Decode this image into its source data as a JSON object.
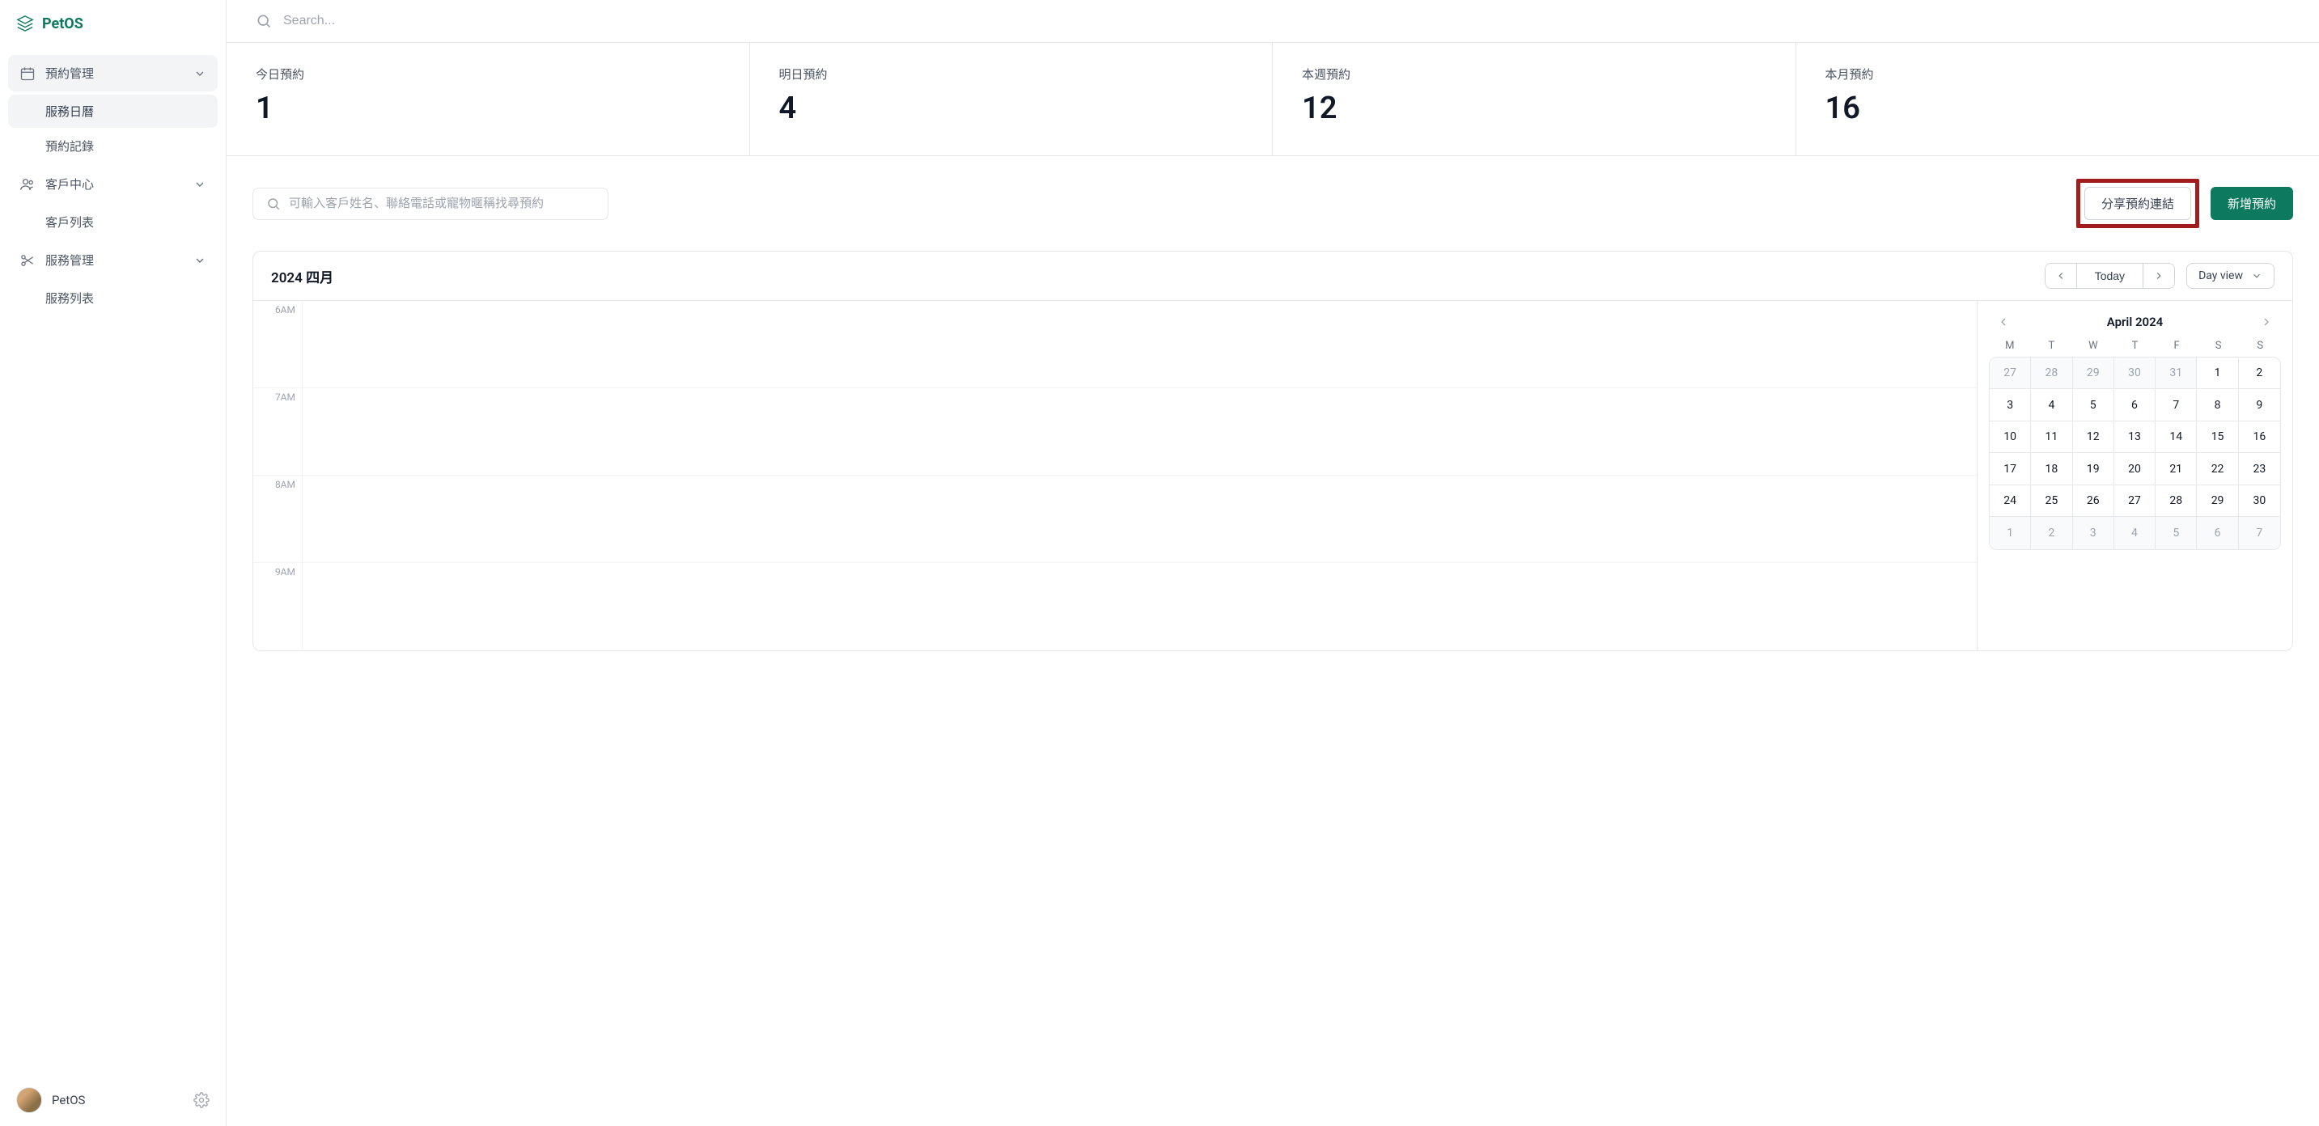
{
  "brand": {
    "name": "PetOS"
  },
  "topbar": {
    "search_placeholder": "Search..."
  },
  "sidebar": {
    "groups": [
      {
        "label": "預約管理",
        "items": [
          "服務日曆",
          "預約記錄"
        ]
      },
      {
        "label": "客戶中心",
        "items": [
          "客戶列表"
        ]
      },
      {
        "label": "服務管理",
        "items": [
          "服務列表"
        ]
      }
    ],
    "footer_name": "PetOS"
  },
  "stats": [
    {
      "label": "今日預約",
      "value": "1"
    },
    {
      "label": "明日預約",
      "value": "4"
    },
    {
      "label": "本週預約",
      "value": "12"
    },
    {
      "label": "本月預約",
      "value": "16"
    }
  ],
  "toolbar": {
    "search_placeholder": "可輸入客戶姓名、聯絡電話或寵物暱稱找尋預約",
    "share_label": "分享預約連結",
    "new_label": "新增預約"
  },
  "calendar": {
    "title": "2024 四月",
    "today_label": "Today",
    "view_label": "Day view",
    "hours": [
      "6AM",
      "7AM",
      "8AM",
      "9AM"
    ]
  },
  "mini_calendar": {
    "title": "April 2024",
    "dow": [
      "M",
      "T",
      "W",
      "T",
      "F",
      "S",
      "S"
    ],
    "cells": [
      {
        "n": "27",
        "other": true
      },
      {
        "n": "28",
        "other": true
      },
      {
        "n": "29",
        "other": true
      },
      {
        "n": "30",
        "other": true
      },
      {
        "n": "31",
        "other": true
      },
      {
        "n": "1"
      },
      {
        "n": "2"
      },
      {
        "n": "3"
      },
      {
        "n": "4"
      },
      {
        "n": "5"
      },
      {
        "n": "6"
      },
      {
        "n": "7"
      },
      {
        "n": "8"
      },
      {
        "n": "9"
      },
      {
        "n": "10"
      },
      {
        "n": "11"
      },
      {
        "n": "12"
      },
      {
        "n": "13"
      },
      {
        "n": "14"
      },
      {
        "n": "15"
      },
      {
        "n": "16"
      },
      {
        "n": "17"
      },
      {
        "n": "18"
      },
      {
        "n": "19"
      },
      {
        "n": "20"
      },
      {
        "n": "21"
      },
      {
        "n": "22"
      },
      {
        "n": "23"
      },
      {
        "n": "24"
      },
      {
        "n": "25"
      },
      {
        "n": "26"
      },
      {
        "n": "27"
      },
      {
        "n": "28"
      },
      {
        "n": "29"
      },
      {
        "n": "30"
      },
      {
        "n": "1",
        "other": true
      },
      {
        "n": "2",
        "other": true
      },
      {
        "n": "3",
        "other": true
      },
      {
        "n": "4",
        "other": true
      },
      {
        "n": "5",
        "other": true
      },
      {
        "n": "6",
        "other": true
      },
      {
        "n": "7",
        "other": true
      }
    ]
  }
}
